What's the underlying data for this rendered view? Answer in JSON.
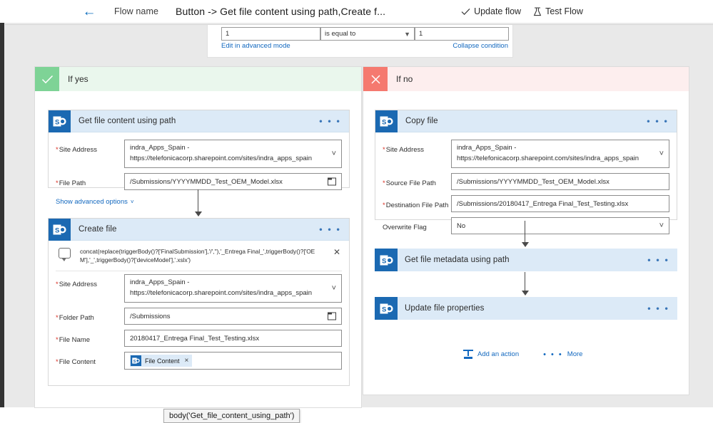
{
  "topbar": {
    "back_icon": "back-arrow-icon",
    "flow_name_label": "Flow name",
    "flow_title": "Button -> Get file content using path,Create f...",
    "update_flow_label": "Update flow",
    "update_flow_icon": "checkmark-icon",
    "test_flow_label": "Test Flow",
    "test_flow_icon": "flask-icon"
  },
  "condition": {
    "value_left": "1",
    "operator": "is equal to",
    "value_right": "1",
    "edit_advanced_link": "Edit in advanced mode",
    "collapse_link": "Collapse condition"
  },
  "branches": {
    "yes": {
      "header": "If yes",
      "badge_icon": "checkmark-icon",
      "badge_color": "#7ed396",
      "header_bg": "#eaf7ed",
      "cards": [
        {
          "title": "Get file content using path",
          "icon": "sharepoint-icon",
          "ellipsis": "• • •",
          "fields": [
            {
              "label": "Site Address",
              "required": true,
              "value_line1": "indra_Apps_Spain -",
              "value_line2": "https://telefonicacorp.sharepoint.com/sites/indra_apps_spain",
              "affix": "chevron-down-icon"
            },
            {
              "label": "File Path",
              "required": true,
              "value_line1": "/Submissions/YYYYMMDD_Test_OEM_Model.xlsx",
              "affix": "folder-picker-icon"
            }
          ],
          "advanced_link": "Show advanced options"
        },
        {
          "title": "Create file",
          "icon": "sharepoint-icon",
          "ellipsis": "• • •",
          "expression": "concat(replace(triggerBody()?['FinalSubmission'],'/',''),'_Entrega Final_',triggerBody()?['OEM'],'_',triggerBody()?['deviceModel'],'.xslx')",
          "expression_icon": "expression-icon",
          "expression_close_icon": "close-icon",
          "fields": [
            {
              "label": "Site Address",
              "required": true,
              "value_line1": "indra_Apps_Spain -",
              "value_line2": "https://telefonicacorp.sharepoint.com/sites/indra_apps_spain",
              "affix": "chevron-down-icon"
            },
            {
              "label": "Folder Path",
              "required": true,
              "value_line1": "/Submissions",
              "affix": "folder-picker-icon"
            },
            {
              "label": "File Name",
              "required": true,
              "value_line1": "20180417_Entrega Final_Test_Testing.xlsx",
              "affix": ""
            },
            {
              "label": "File Content",
              "required": true,
              "token": "File Content",
              "token_icon": "sharepoint-icon",
              "token_close": "×",
              "affix": ""
            }
          ]
        }
      ]
    },
    "no": {
      "header": "If no",
      "badge_icon": "close-icon",
      "badge_color": "#f5796f",
      "header_bg": "#fdeeee",
      "cards": [
        {
          "title": "Copy file",
          "icon": "sharepoint-icon",
          "ellipsis": "• • •",
          "fields": [
            {
              "label": "Site Address",
              "required": true,
              "value_line1": "indra_Apps_Spain -",
              "value_line2": "https://telefonicacorp.sharepoint.com/sites/indra_apps_spain",
              "affix": "chevron-down-icon"
            },
            {
              "label": "Source File Path",
              "required": true,
              "value_line1": "/Submissions/YYYYMMDD_Test_OEM_Model.xlsx",
              "affix": ""
            },
            {
              "label": "Destination File Path",
              "required": true,
              "value_line1": "/Submissions/20180417_Entrega Final_Test_Testing.xlsx",
              "affix": ""
            },
            {
              "label": "Overwrite Flag",
              "required": false,
              "value_line1": "No",
              "affix": "chevron-down-icon"
            }
          ]
        },
        {
          "title": "Get file metadata using path",
          "icon": "sharepoint-icon",
          "ellipsis": "• • •",
          "collapsed": true
        },
        {
          "title": "Update file properties",
          "icon": "sharepoint-icon",
          "ellipsis": "• • •",
          "collapsed": true
        }
      ],
      "footer": {
        "add_action_label": "Add an action",
        "add_action_icon": "add-action-icon",
        "more_label": "More",
        "more_dots": "• • •"
      }
    }
  },
  "tooltip": {
    "text": "body('Get_file_content_using_path')"
  },
  "colors": {
    "accent_blue": "#1268bf",
    "sharepoint_blue": "#1b69b2",
    "card_header_bg": "#dceaf7",
    "canvas_bg": "#e9e9e9",
    "required_red": "#d93025"
  }
}
